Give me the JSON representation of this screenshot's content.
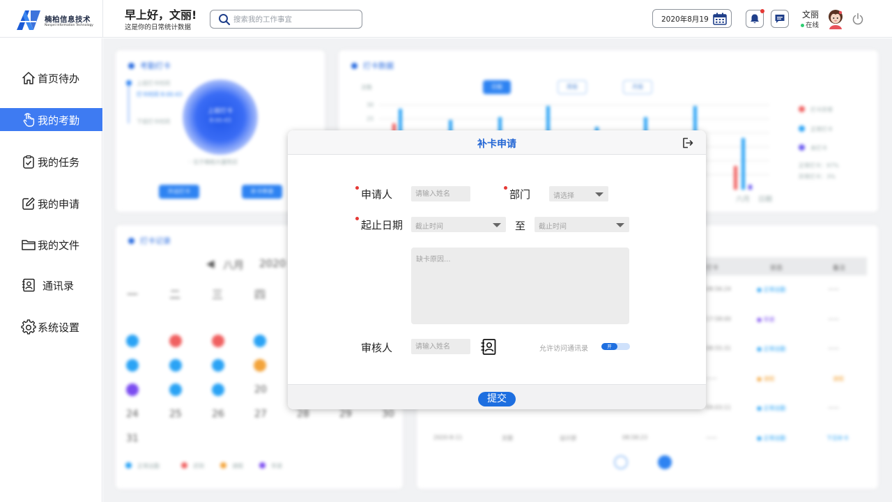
{
  "brand": {
    "name_cn": "楠柏信息技术",
    "name_en": "Nanpei Information Technology",
    "color": "#1b5bd6"
  },
  "header": {
    "greeting": "早上好，文丽!",
    "subtitle": "这是你的日常统计数据",
    "search_placeholder": "搜索我的工作事宜",
    "date": "2020年8月19",
    "user_name": "文丽",
    "user_status": "在线",
    "notification_dot": true
  },
  "sidebar": {
    "active_color": "#3e7bf2",
    "items": [
      {
        "label": "首页待办",
        "icon": "home-icon"
      },
      {
        "label": "我的考勤",
        "icon": "hand-touch-icon",
        "active": true
      },
      {
        "label": "我的任务",
        "icon": "clipboard-check-icon"
      },
      {
        "label": "我的申请",
        "icon": "edit-icon"
      },
      {
        "label": "我的文件",
        "icon": "folder-icon"
      },
      {
        "label": "通讯录",
        "icon": "contact-book-icon"
      },
      {
        "label": "系统设置",
        "icon": "gear-icon"
      }
    ]
  },
  "background": {
    "card1_title": "考勤打卡",
    "card2_title": "打卡数据",
    "card3_title": "打卡记录",
    "punch_circle_title": "上班打卡",
    "punch_circle_time": "8:00:43",
    "btn_out": "外出打卡",
    "btn_apply": "补卡申请",
    "tabs": [
      "日报",
      "周报",
      "月报"
    ],
    "chart_ylabel": "次数",
    "chart_days": [
      "六月",
      "日期"
    ],
    "legend": [
      "打卡异常",
      "正常打卡",
      "未打卡"
    ],
    "rates": [
      "正常打卡：97%",
      "异常打卡：3%"
    ],
    "calendar_month": "八月",
    "calendar_year": "2020",
    "weekdays": [
      "一",
      "二",
      "三",
      "四"
    ],
    "calendar_rows": [
      [
        "24",
        "25",
        "26",
        "27",
        "28",
        "29",
        "30"
      ],
      [
        "31"
      ]
    ],
    "calendar_legend": [
      "正常出勤",
      "迟到",
      "请假",
      "早退"
    ],
    "table_headers": [
      "打卡",
      "状态",
      "备注"
    ],
    "table_row_date": "2020-8-11",
    "table_row_name": "文丽",
    "table_row_dept": "设计部",
    "table_row_time": "08:58:23"
  },
  "modal": {
    "title": "补卡申请",
    "applicant_label": "申请人",
    "applicant_placeholder": "请输入姓名",
    "dept_label": "部门",
    "dept_placeholder": "请选择",
    "date_label": "起止日期",
    "start_placeholder": "截止时间",
    "to_label": "至",
    "end_placeholder": "截止时间",
    "reason_placeholder": "缺卡原因...",
    "reviewer_label": "审核人",
    "reviewer_placeholder": "请输入姓名",
    "allow_contacts_label": "允许访问通讯录",
    "toggle_label": "开",
    "toggle_on": true,
    "submit_label": "提交"
  }
}
